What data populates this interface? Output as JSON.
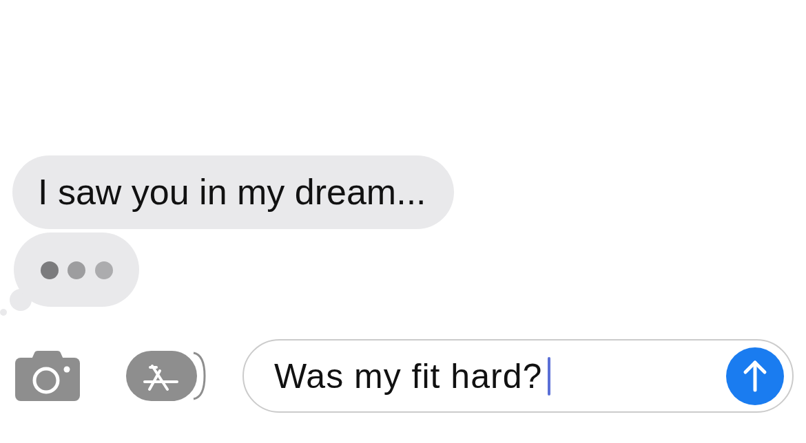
{
  "messages": [
    {
      "kind": "text",
      "text": "I saw you in my dream..."
    },
    {
      "kind": "typing"
    }
  ],
  "composer": {
    "value": "Was my fit hard?",
    "focused": true
  }
}
